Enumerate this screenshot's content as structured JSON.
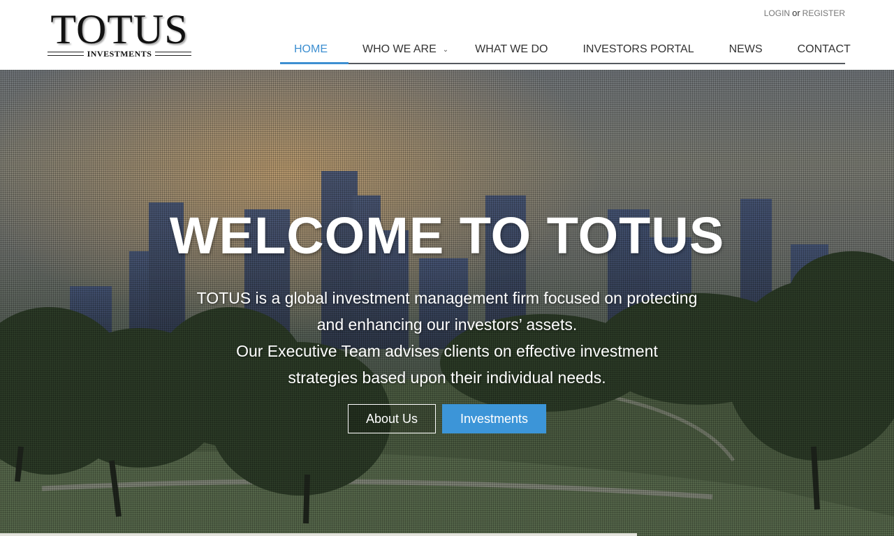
{
  "header": {
    "logo": {
      "wordmark": "TOTUS",
      "subtitle": "INVESTMENTS"
    },
    "auth": {
      "login": "LOGIN",
      "separator": "or",
      "register": "REGISTER"
    },
    "nav": [
      {
        "label": "HOME",
        "active": true
      },
      {
        "label": "WHO WE ARE",
        "has_dropdown": true
      },
      {
        "label": "WHAT WE DO"
      },
      {
        "label": "INVESTORS PORTAL"
      },
      {
        "label": "NEWS"
      },
      {
        "label": "CONTACT"
      }
    ]
  },
  "hero": {
    "title": "WELCOME TO TOTUS",
    "text_lines": [
      "TOTUS is a global investment management firm focused on protecting",
      "and enhancing our investors’ assets.",
      "Our Executive Team advises clients on effective investment",
      "strategies based upon their individual needs."
    ],
    "buttons": {
      "about": "About Us",
      "investments": "Investments"
    },
    "background": "city skyline behind park trees"
  },
  "colors": {
    "accent": "#3d8fd1",
    "primary_button": "#3c95d8",
    "nav_text": "#333333",
    "hero_text": "#ffffff"
  },
  "icons": {
    "dropdown": "chevron-down-icon"
  }
}
